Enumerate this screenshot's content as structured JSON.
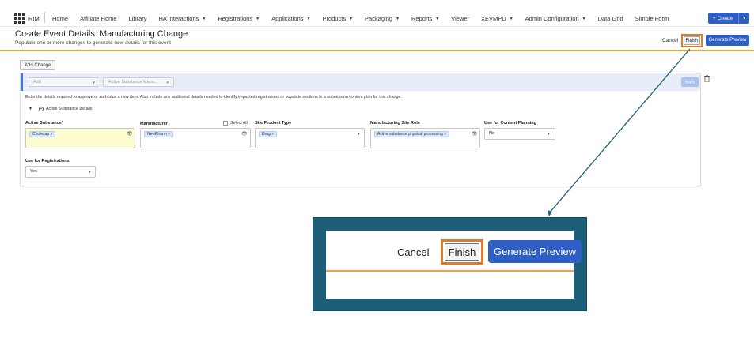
{
  "nav": {
    "app_name": "RIM",
    "items": [
      {
        "label": "Home",
        "has_caret": false
      },
      {
        "label": "Affiliate Home",
        "has_caret": false
      },
      {
        "label": "Library",
        "has_caret": false
      },
      {
        "label": "HA Interactions",
        "has_caret": true
      },
      {
        "label": "Registrations",
        "has_caret": true
      },
      {
        "label": "Applications",
        "has_caret": true
      },
      {
        "label": "Products",
        "has_caret": true
      },
      {
        "label": "Packaging",
        "has_caret": true
      },
      {
        "label": "Reports",
        "has_caret": true
      },
      {
        "label": "Viewer",
        "has_caret": false
      },
      {
        "label": "XEVMPD",
        "has_caret": true
      },
      {
        "label": "Admin Configuration",
        "has_caret": true
      },
      {
        "label": "Data Grid",
        "has_caret": false
      },
      {
        "label": "Simple Form",
        "has_caret": false
      }
    ],
    "create_label": "+ Create"
  },
  "header": {
    "title": "Create Event Details: Manufacturing Change",
    "subtitle": "Populate one or more changes to generate new details for this event",
    "cancel": "Cancel",
    "finish": "Finish",
    "generate_preview": "Generate Preview"
  },
  "add_change_label": "Add Change",
  "change": {
    "add_select": "Add",
    "type_select": "Active Substance Manu...",
    "apply": "Apply",
    "instructions": "Enter the details required to approve or authorize a new item. Also include any additional details needed to identify impacted registrations or populate sections in a submission content plan for this change.",
    "section_toggle": "Active Substance Details",
    "fields": {
      "active_substance": {
        "label": "Active Substance*",
        "chip": "Cholecap ×"
      },
      "manufacturer": {
        "label": "Manufacturer",
        "select_all": "Select All",
        "chip": "NewPharm ×"
      },
      "site_product_type": {
        "label": "Site Product Type",
        "chip": "Drug ×"
      },
      "manufacturing_site_role": {
        "label": "Manufacturing Site Role",
        "chip": "Active substance physical processing ×"
      },
      "content_planning": {
        "label": "Use for Content Planning",
        "value": "No"
      },
      "registrations": {
        "label": "Use for Registrations",
        "value": "Yes"
      }
    }
  },
  "zoom": {
    "cancel": "Cancel",
    "finish": "Finish",
    "generate_preview": "Generate Preview"
  },
  "colors": {
    "accent_blue": "#2f5fc4",
    "highlight_orange": "#e07b2a",
    "callout_teal": "#1d5f79",
    "required_yellow": "#fdfbd0"
  }
}
